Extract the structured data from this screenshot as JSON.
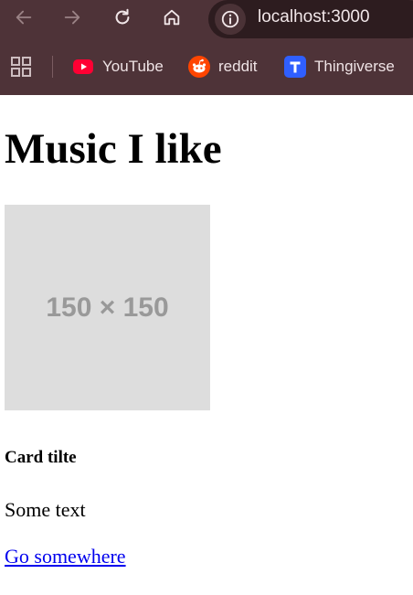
{
  "browser": {
    "url": "localhost:3000",
    "bookmarks": [
      {
        "label": "YouTube",
        "icon": "youtube-icon",
        "color": "#ff0033"
      },
      {
        "label": "reddit",
        "icon": "reddit-icon",
        "color": "#ff4500"
      },
      {
        "label": "Thingiverse",
        "icon": "thingiverse-icon",
        "color": "#2f5fff"
      }
    ]
  },
  "page": {
    "heading": "Music I like",
    "card": {
      "image_placeholder": "150 × 150",
      "title": "Card tilte",
      "text": "Some text",
      "link": "Go somewhere"
    }
  },
  "colors": {
    "chrome_bg": "#4e3338",
    "urlbar_bg": "#2d1c1f",
    "link": "#0000ee",
    "placeholder_bg": "#dddddd"
  }
}
